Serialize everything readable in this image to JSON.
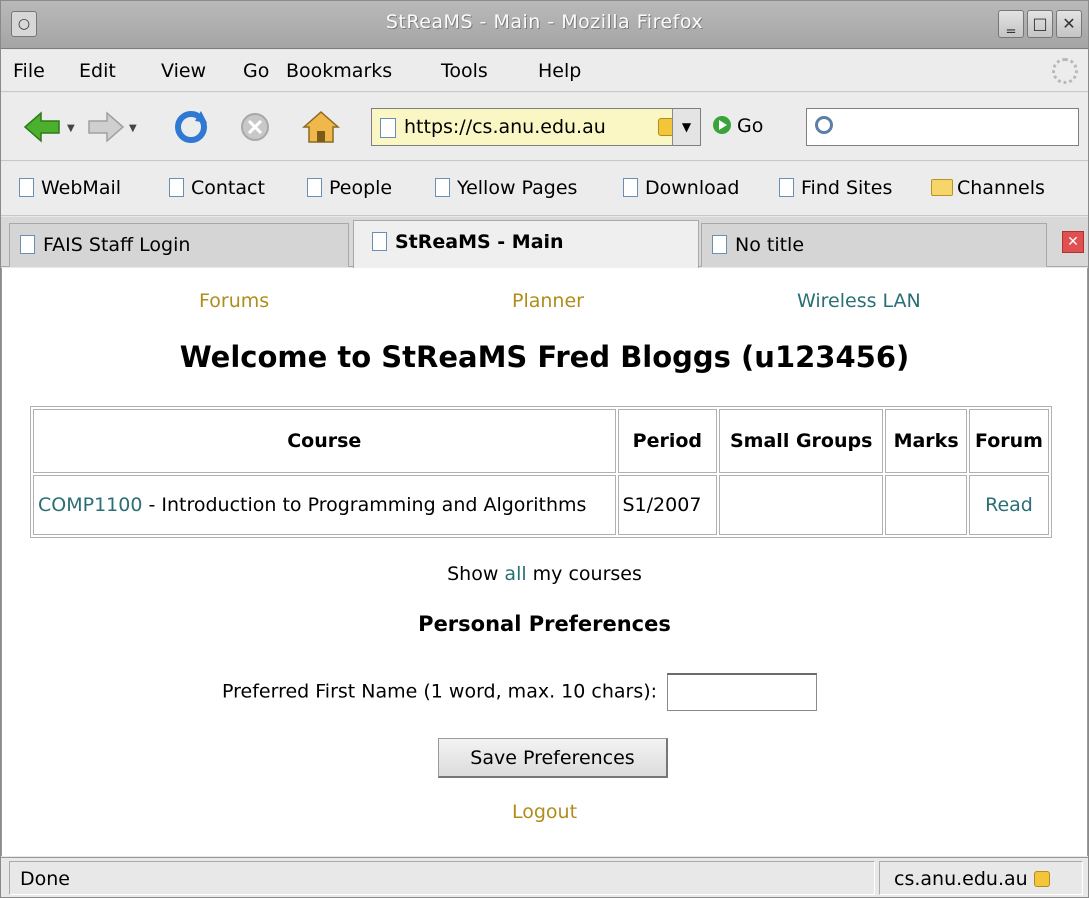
{
  "window": {
    "title": "StReaMS - Main - Mozilla Firefox"
  },
  "menu": {
    "items": [
      {
        "label": "File"
      },
      {
        "label": "Edit"
      },
      {
        "label": "View"
      },
      {
        "label": "Go"
      },
      {
        "label": "Bookmarks"
      },
      {
        "label": "Tools"
      },
      {
        "label": "Help"
      }
    ]
  },
  "navbar": {
    "url": "https://cs.anu.edu.au",
    "go_label": "Go",
    "search_value": ""
  },
  "bookmarks": [
    {
      "label": "WebMail"
    },
    {
      "label": "Contact"
    },
    {
      "label": "People"
    },
    {
      "label": "Yellow Pages"
    },
    {
      "label": "Download"
    },
    {
      "label": "Find Sites"
    },
    {
      "label": "Channels"
    }
  ],
  "tabs": [
    {
      "label": "FAIS Staff Login"
    },
    {
      "label": "StReaMS - Main",
      "active": true
    },
    {
      "label": "No title"
    }
  ],
  "content": {
    "top_links": [
      {
        "label": "Forums"
      },
      {
        "label": "Planner"
      },
      {
        "label": "Wireless LAN"
      }
    ],
    "welcome": "Welcome to StReaMS Fred Bloggs (u123456)",
    "table": {
      "headers": [
        "Course",
        "Period",
        "Small Groups",
        "Marks",
        "Forum"
      ],
      "rows": [
        {
          "code": "COMP1100",
          "name": " - Introduction to Programming and Algorithms",
          "period": "S1/2007",
          "small_groups": "",
          "marks": "",
          "forum": "Read"
        }
      ]
    },
    "show_all": {
      "before": "Show ",
      "link": "all",
      "after": " my courses"
    },
    "prefs_heading": "Personal Preferences",
    "pref_label": "Preferred First Name (1 word, max. 10 chars):",
    "pref_value": "",
    "save_label": "Save Preferences",
    "logout": "Logout"
  },
  "status": {
    "left": "Done",
    "right": "cs.anu.edu.au"
  },
  "colors": {
    "link_olive": "#b08d1a",
    "link_teal": "#2a6f75"
  }
}
